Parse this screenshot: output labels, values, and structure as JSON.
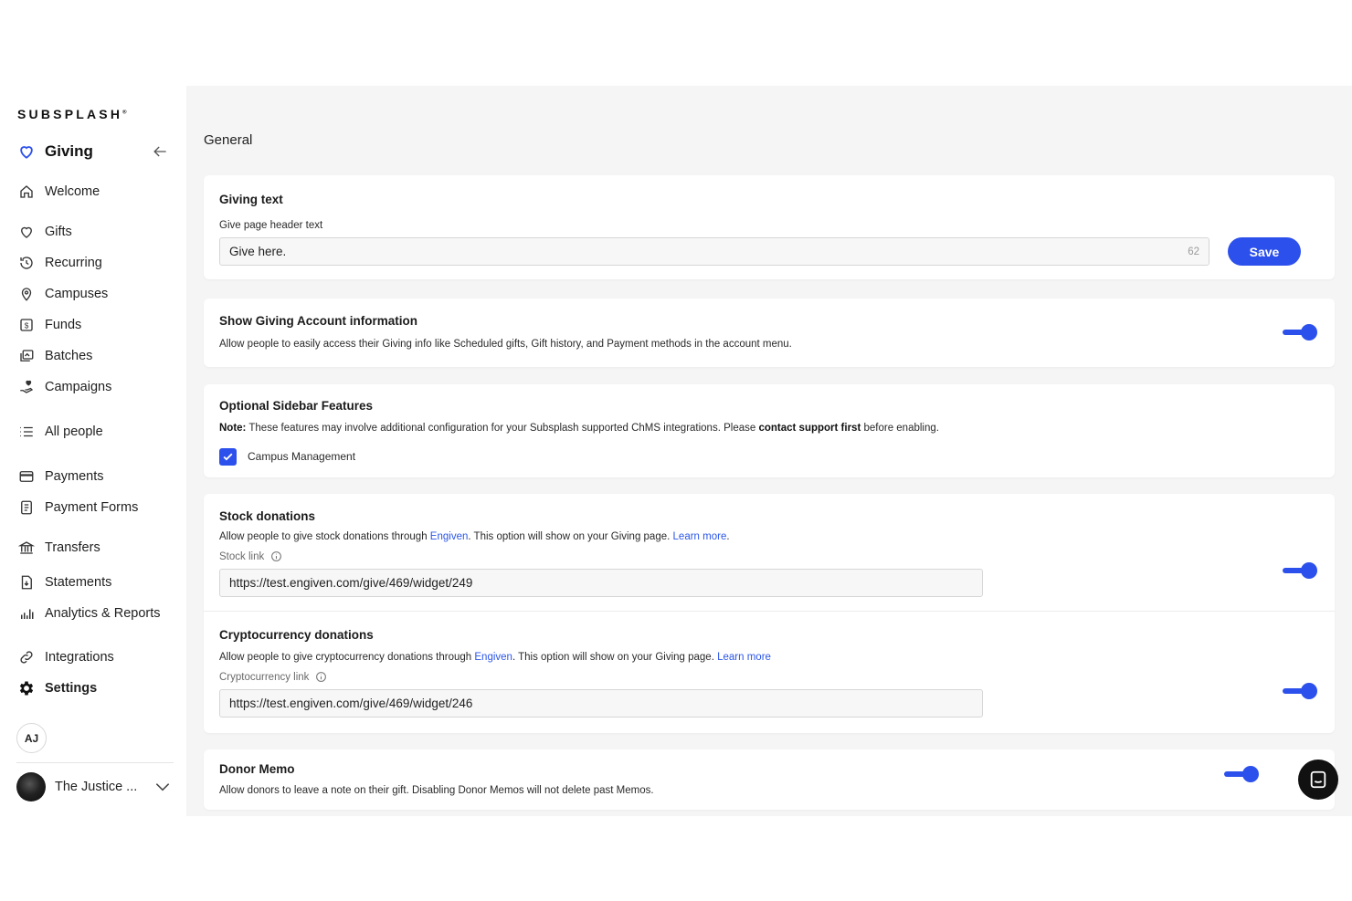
{
  "brand": {
    "logo_text": "SUBSPLASH",
    "accent": "#2c50ec"
  },
  "sidebar": {
    "section_title": "Giving",
    "items": [
      {
        "label": "Welcome",
        "icon": "home-icon"
      },
      {
        "label": "Gifts",
        "icon": "heart-outline-icon"
      },
      {
        "label": "Recurring",
        "icon": "history-icon"
      },
      {
        "label": "Campuses",
        "icon": "location-pin-icon"
      },
      {
        "label": "Funds",
        "icon": "dollar-box-icon"
      },
      {
        "label": "Batches",
        "icon": "batches-icon"
      },
      {
        "label": "Campaigns",
        "icon": "hand-heart-icon"
      },
      {
        "label": "All people",
        "icon": "list-icon"
      },
      {
        "label": "Payments",
        "icon": "credit-card-icon"
      },
      {
        "label": "Payment Forms",
        "icon": "form-icon"
      },
      {
        "label": "Transfers",
        "icon": "bank-icon"
      },
      {
        "label": "Statements",
        "icon": "statement-icon"
      },
      {
        "label": "Analytics & Reports",
        "icon": "bar-chart-icon"
      },
      {
        "label": "Integrations",
        "icon": "link-icon"
      },
      {
        "label": "Settings",
        "icon": "gear-icon"
      }
    ],
    "active": "Settings",
    "user_initials": "AJ",
    "org_name": "The Justice ..."
  },
  "main": {
    "page_title": "General",
    "giving_text": {
      "title": "Giving text",
      "field_label": "Give page header text",
      "value": "Give here.",
      "char_count": "62",
      "save_label": "Save"
    },
    "account_info": {
      "title": "Show Giving Account information",
      "description": "Allow people to easily access their Giving info like Scheduled gifts, Gift history, and Payment methods in the account menu.",
      "enabled": true
    },
    "sidebar_features": {
      "title": "Optional Sidebar Features",
      "note_label": "Note:",
      "note_text_1": "These features may involve additional configuration for your Subsplash supported ChMS integrations. Please",
      "note_bold": "contact support first",
      "note_text_2": "before enabling.",
      "checkbox_label": "Campus Management",
      "checked": true
    },
    "stock": {
      "title": "Stock donations",
      "desc_1": "Allow people to give stock donations through",
      "provider": "Engiven",
      "desc_2": ". This option will show on your Giving page.",
      "learn_more": "Learn more",
      "field_label": "Stock link",
      "value": "https://test.engiven.com/give/469/widget/249",
      "enabled": true
    },
    "crypto": {
      "title": "Cryptocurrency donations",
      "desc_1": "Allow people to give cryptocurrency donations through",
      "provider": "Engiven",
      "desc_2": ". This option will show on your Giving page.",
      "learn_more": "Learn more",
      "field_label": "Cryptocurrency link",
      "value": "https://test.engiven.com/give/469/widget/246",
      "enabled": true
    },
    "donor_memo": {
      "title": "Donor Memo",
      "description": "Allow donors to leave a note on their gift. Disabling Donor Memos will not delete past Memos.",
      "enabled": true
    }
  }
}
